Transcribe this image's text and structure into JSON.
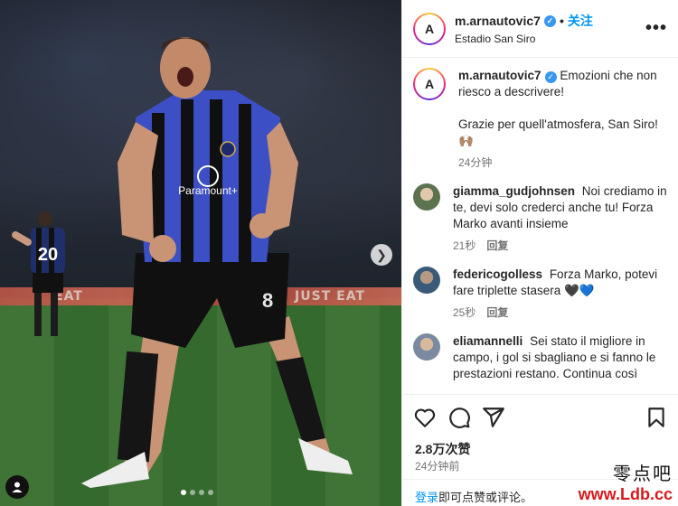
{
  "header": {
    "username": "m.arnautovic7",
    "separator": "•",
    "follow_label": "关注",
    "location": "Estadio San Siro",
    "more_label": "•••"
  },
  "caption": {
    "username": "m.arnautovic7",
    "text1": "Emozioni che non riesco a descrivere!",
    "text2": "Grazie per quell'atmosfera, San Siro! 🙌🏽",
    "time": "24分钟"
  },
  "comments": [
    {
      "username": "giamma_gudjohnsen",
      "text": "Noi crediamo in te, devi solo crederci anche tu! Forza Marko avanti insieme",
      "time": "21秒",
      "reply": "回复"
    },
    {
      "username": "federicogolless",
      "text": "Forza Marko, potevi fare triplette stasera",
      "time": "25秒",
      "reply": "回复"
    },
    {
      "username": "eliamannelli",
      "text": "Sei stato il migliore in campo, i gol si sbagliano e si fanno le prestazioni restano. Continua così",
      "time": "",
      "reply": ""
    }
  ],
  "likes": "2.8万次赞",
  "post_time": "24分钟前",
  "login": {
    "link": "登录",
    "rest": "即可点赞或评论。"
  },
  "media": {
    "ad_left": "EAT",
    "ad_right": "JUST EAT",
    "jersey_sponsor": "Paramount+",
    "player_number": "8",
    "bg_player_number": "20",
    "carousel_dots": 4,
    "active_dot": 1
  },
  "watermark": {
    "cn": "零点吧",
    "url": "www.Ldb.cc"
  },
  "colors": {
    "link": "#0095f6",
    "verified": "#3897f0",
    "jersey_blue": "#3c4fc4"
  },
  "icons": [
    "heart-icon",
    "comment-icon",
    "share-icon",
    "bookmark-icon",
    "chevron-right-icon",
    "user-icon",
    "verified-icon"
  ]
}
